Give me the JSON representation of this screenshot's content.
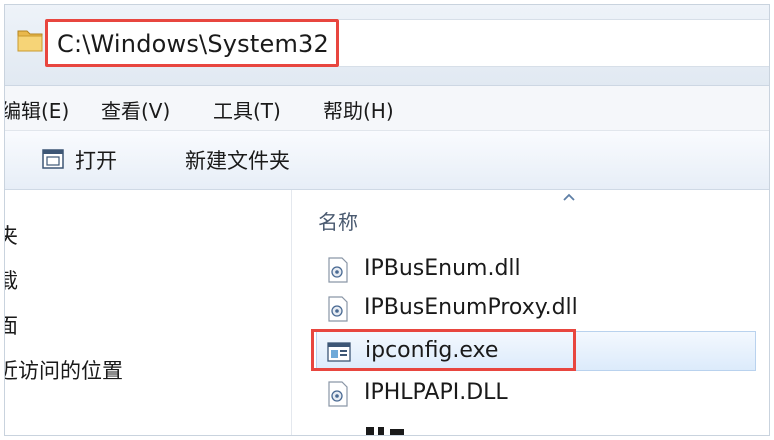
{
  "address_bar": {
    "path": "C:\\Windows\\System32"
  },
  "menu": {
    "items": [
      {
        "label": "编辑(E)"
      },
      {
        "label": "查看(V)"
      },
      {
        "label": "工具(T)"
      },
      {
        "label": "帮助(H)"
      }
    ]
  },
  "toolbar": {
    "open_label": "打开",
    "new_folder_label": "新建文件夹"
  },
  "nav_pane": {
    "items": [
      {
        "label": "夹"
      },
      {
        "label": "载"
      },
      {
        "label": "面"
      },
      {
        "label": "近访问的位置"
      }
    ]
  },
  "file_list": {
    "column_name": "名称",
    "files": [
      {
        "name": "IPBusEnum.dll",
        "icon": "dll-file-icon"
      },
      {
        "name": "IPBusEnumProxy.dll",
        "icon": "dll-file-icon"
      },
      {
        "name": "ipconfig.exe",
        "icon": "exe-file-icon",
        "selected": true
      },
      {
        "name": "IPHLPAPI.DLL",
        "icon": "dll-file-icon"
      }
    ]
  },
  "colors": {
    "highlight_border": "#e8463f",
    "selection_bg": "#dcebfb"
  }
}
